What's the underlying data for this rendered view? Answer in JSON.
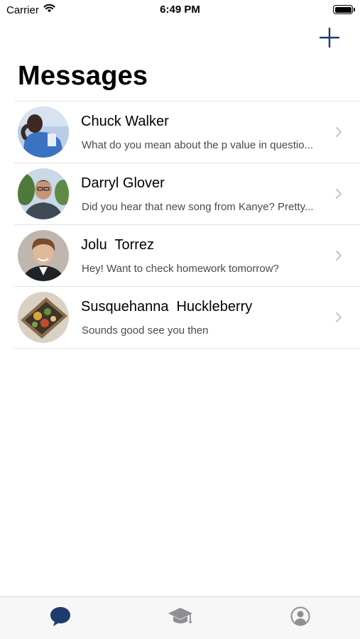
{
  "status_bar": {
    "carrier": "Carrier",
    "time": "6:49 PM"
  },
  "header": {
    "title": "Messages",
    "add_icon": "plus-icon"
  },
  "colors": {
    "accent": "#1f3b6e",
    "inactive_tab": "#8e8e93",
    "separator": "#e3e3e6",
    "chevron": "#c4c4c7"
  },
  "messages": [
    {
      "name": "Chuck Walker",
      "preview": "What do you mean about the p value in questio...",
      "avatar": "chuck-walker-photo"
    },
    {
      "name": "Darryl Glover",
      "preview": "Did you hear that new song from Kanye? Pretty...",
      "avatar": "darryl-glover-photo"
    },
    {
      "name": "Jolu  Torrez",
      "preview": "Hey! Want to check homework tomorrow?",
      "avatar": "jolu-torrez-photo"
    },
    {
      "name": "Susquehanna  Huckleberry",
      "preview": "Sounds good see you then",
      "avatar": "susquehanna-huckleberry-photo"
    }
  ],
  "tab_bar": {
    "tabs": [
      {
        "icon": "chat-bubble-icon",
        "active": true
      },
      {
        "icon": "graduation-cap-icon",
        "active": false
      },
      {
        "icon": "person-circle-icon",
        "active": false
      }
    ]
  }
}
